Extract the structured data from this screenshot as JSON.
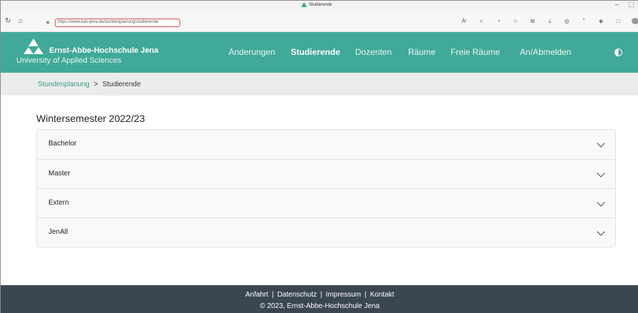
{
  "browser": {
    "tab_title": "Studierende",
    "url": "https://www.eah-jena.de/stundenplanung/studierende",
    "minimize": "–",
    "extra_control": "⬚",
    "icons": [
      "back-icon",
      "home-icon",
      "lock-icon",
      "read-aloud-icon",
      "zoom-icon",
      "tracking-icon",
      "favorite-icon",
      "collections-icon",
      "downloads-icon",
      "browser-essentials-icon",
      "quote-icon",
      "copilot-icon",
      "extensions-icon",
      "profile-icon"
    ]
  },
  "header": {
    "logo_name": "Ernst-Abbe-Hochschule Jena",
    "logo_sub": "University of Applied Sciences",
    "nav": [
      {
        "label": "Änderungen"
      },
      {
        "label": "Studierende"
      },
      {
        "label": "Dozenten"
      },
      {
        "label": "Räume"
      },
      {
        "label": "Freie Räume"
      },
      {
        "label": "An/Abmelden"
      }
    ],
    "brand_color": "#40a999"
  },
  "breadcrumb": {
    "home": "Stundenplanung",
    "separator": ">",
    "current": "Studierende"
  },
  "main": {
    "semester_title": "Wintersemester 2022/23",
    "sections": [
      {
        "label": "Bachelor"
      },
      {
        "label": "Master"
      },
      {
        "label": "Extern"
      },
      {
        "label": "JenAll"
      }
    ]
  },
  "footer": {
    "links": [
      "Anfahrt",
      "Datenschutz",
      "Impressum",
      "Kontakt"
    ],
    "separator": "|",
    "copyright": "© 2023, Ernst-Abbe-Hochschule Jena"
  }
}
